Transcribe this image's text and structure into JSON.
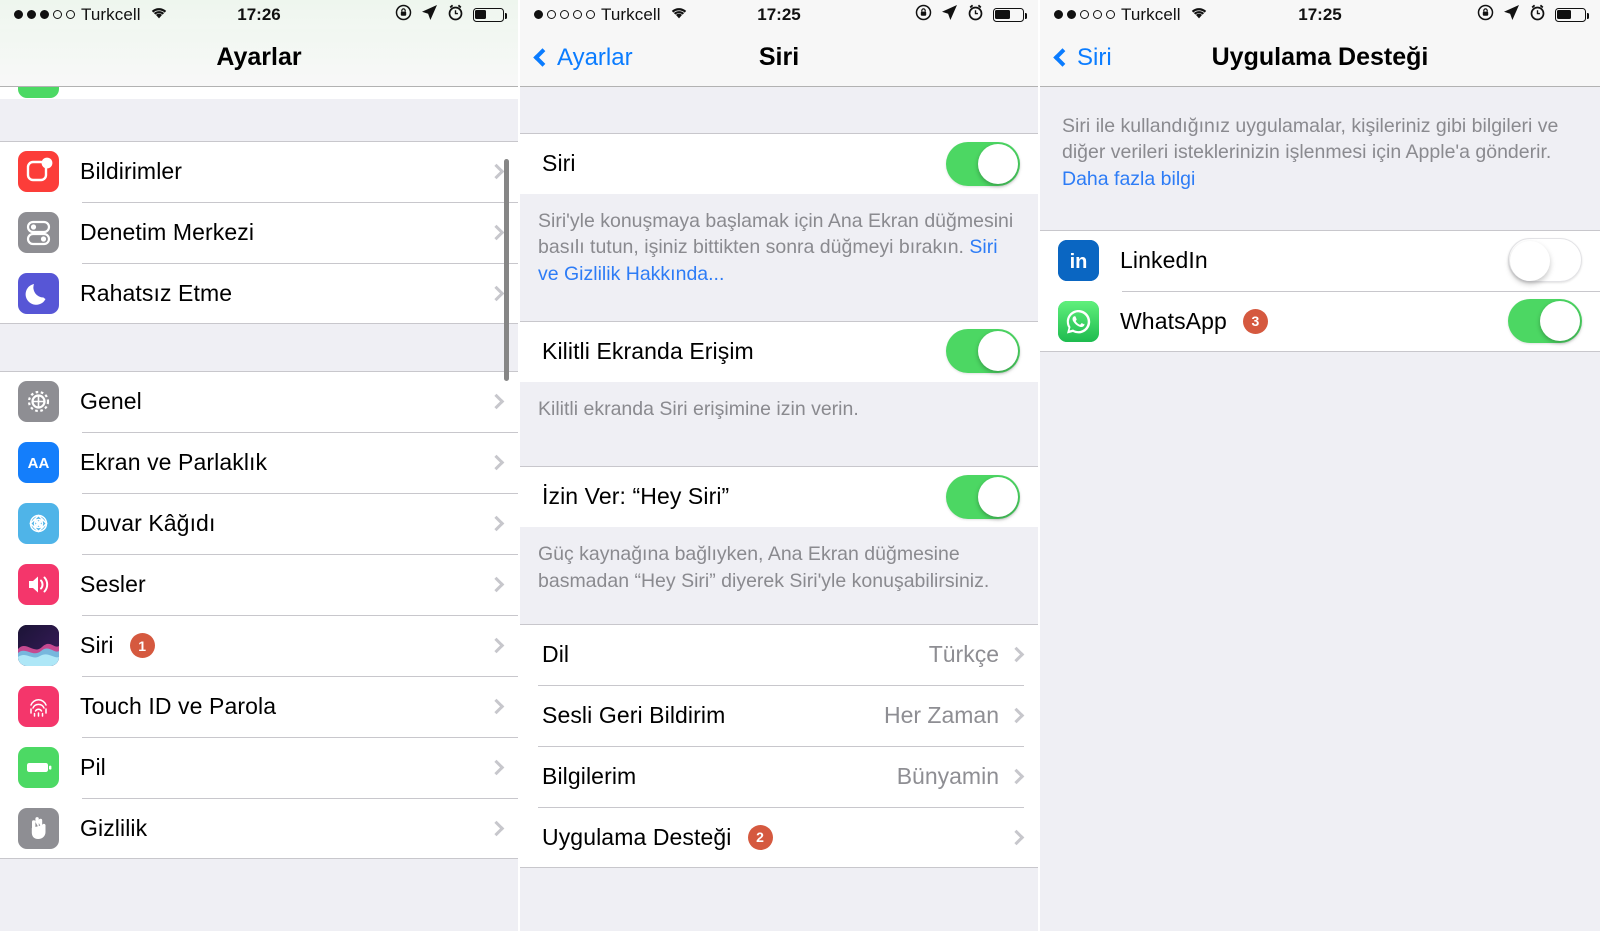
{
  "panels": [
    {
      "id": "settings-root",
      "status": {
        "signal_filled": 3,
        "signal_total": 5,
        "carrier": "Turkcell",
        "time": "17:26"
      },
      "nav": {
        "title": "Ayarlar",
        "back": null
      },
      "groups": [
        {
          "rows": [
            {
              "label": "Bildirimler",
              "icon": "notifications-icon",
              "accessory": "chevron"
            },
            {
              "label": "Denetim Merkezi",
              "icon": "control-center-icon",
              "accessory": "chevron"
            },
            {
              "label": "Rahatsız Etme",
              "icon": "do-not-disturb-icon",
              "accessory": "chevron"
            }
          ]
        },
        {
          "rows": [
            {
              "label": "Genel",
              "icon": "general-gear-icon",
              "accessory": "chevron"
            },
            {
              "label": "Ekran ve Parlaklık",
              "icon": "display-brightness-icon",
              "accessory": "chevron"
            },
            {
              "label": "Duvar Kâğıdı",
              "icon": "wallpaper-icon",
              "accessory": "chevron"
            },
            {
              "label": "Sesler",
              "icon": "sounds-icon",
              "accessory": "chevron"
            },
            {
              "label": "Siri",
              "icon": "siri-icon",
              "badge": "1",
              "accessory": "chevron"
            },
            {
              "label": "Touch ID ve Parola",
              "icon": "touch-id-icon",
              "accessory": "chevron"
            },
            {
              "label": "Pil",
              "icon": "battery-icon",
              "accessory": "chevron"
            },
            {
              "label": "Gizlilik",
              "icon": "privacy-hand-icon",
              "accessory": "chevron"
            }
          ]
        }
      ]
    },
    {
      "id": "siri-settings",
      "status": {
        "signal_filled": 1,
        "signal_total": 5,
        "carrier": "Turkcell",
        "time": "17:25"
      },
      "nav": {
        "title": "Siri",
        "back": "Ayarlar"
      },
      "rows": {
        "siri": {
          "label": "Siri",
          "toggle": "on"
        },
        "lock_screen": {
          "label": "Kilitli Ekranda Erişim",
          "toggle": "on"
        },
        "hey_siri": {
          "label": "İzin Ver: “Hey Siri”",
          "toggle": "on"
        },
        "dil": {
          "label": "Dil",
          "value": "Türkçe"
        },
        "sesli": {
          "label": "Sesli Geri Bildirim",
          "value": "Her Zaman"
        },
        "bilgilerim": {
          "label": "Bilgilerim",
          "value": "Bünyamin"
        },
        "uygulama": {
          "label": "Uygulama Desteği",
          "badge": "2"
        }
      },
      "footnotes": {
        "siri": "Siri'yle konuşmaya başlamak için Ana Ekran düğmesini basılı tutun, işiniz bittikten sonra düğmeyi bırakın. ",
        "siri_link": "Siri ve Gizlilik Hakkında...",
        "lock_screen": "Kilitli ekranda Siri erişimine izin verin.",
        "hey_siri": "Güç kaynağına bağlıyken, Ana Ekran düğmesine basmadan “Hey Siri” diyerek Siri'yle konuşabilirsiniz."
      }
    },
    {
      "id": "app-support",
      "status": {
        "signal_filled": 2,
        "signal_total": 5,
        "carrier": "Turkcell",
        "time": "17:25"
      },
      "nav": {
        "title": "Uygulama Desteği",
        "back": "Siri"
      },
      "footnote": {
        "text": "Siri ile kullandığınız uygulamalar, kişileriniz gibi bilgileri ve diğer verileri isteklerinizin işlenmesi için Apple'a gönderir. ",
        "link": "Daha fazla bilgi"
      },
      "apps": [
        {
          "label": "LinkedIn",
          "icon": "linkedin-icon",
          "toggle": "off",
          "badge": null
        },
        {
          "label": "WhatsApp",
          "icon": "whatsapp-icon",
          "toggle": "on",
          "badge": "3"
        }
      ]
    }
  ],
  "colors": {
    "accent_blue": "#0a7cff",
    "switch_green": "#4cd763",
    "badge_orange": "#d5593f",
    "group_bg": "#efeff4",
    "separator": "#c8c7cc"
  }
}
